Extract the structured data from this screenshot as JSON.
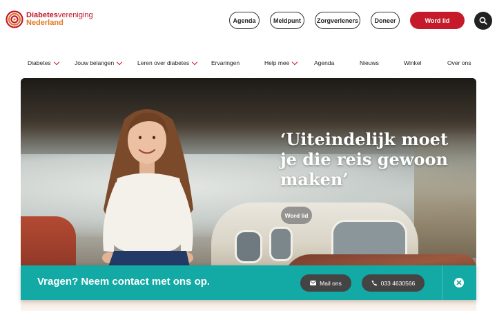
{
  "header": {
    "logo_line1_bold": "Diabetes",
    "logo_line1_rest": "vereniging",
    "logo_line2": "Nederland",
    "buttons": {
      "agenda": "Agenda",
      "meldpunt": "Meldpunt",
      "zorgverleners": "Zorgverleners",
      "doneer": "Doneer",
      "word_lid": "Word lid"
    },
    "search_icon": "search-icon"
  },
  "nav": {
    "items": [
      {
        "label": "Diabetes",
        "dropdown": true
      },
      {
        "label": "Jouw belangen",
        "dropdown": true
      },
      {
        "label": "Leren over diabetes",
        "dropdown": true
      },
      {
        "label": "Ervaringen",
        "dropdown": false
      },
      {
        "label": "Help mee",
        "dropdown": true
      },
      {
        "label": "Agenda",
        "dropdown": false
      },
      {
        "label": "Nieuws",
        "dropdown": false
      },
      {
        "label": "Winkel",
        "dropdown": false
      },
      {
        "label": "Over ons",
        "dropdown": false
      }
    ]
  },
  "hero": {
    "quote": "‘Uiteindelijk moet je die reis gewoon maken’",
    "cta": "Word lid"
  },
  "contact": {
    "text": "Vragen? Neem contact met ons op.",
    "mail_label": "Mail ons",
    "phone_label": "033 4630566",
    "mail_icon": "mail-icon",
    "phone_icon": "phone-icon",
    "close_icon": "close-icon"
  },
  "colors": {
    "brand_red": "#c51a2a",
    "brand_orange": "#e07a22",
    "teal": "#13a9a4"
  }
}
